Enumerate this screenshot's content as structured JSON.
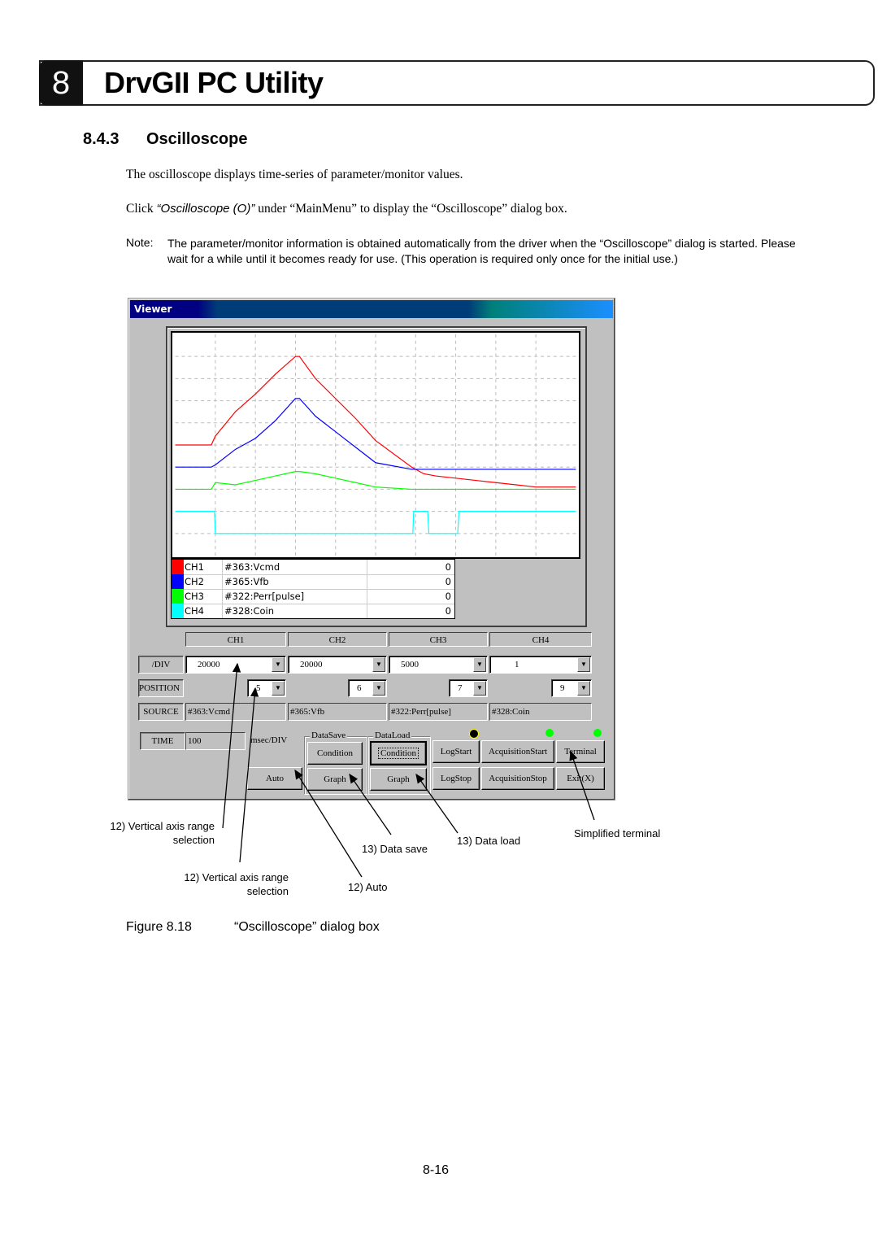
{
  "chapter": {
    "number": "8",
    "title": "DrvGII PC Utility"
  },
  "section": {
    "number": "8.4.3",
    "title": "Oscilloscope"
  },
  "paragraphs": {
    "p1": "The oscilloscope displays time-series of parameter/monitor values.",
    "p2_prefix": "Click ",
    "p2_italic": "“Oscilloscope (O)”",
    "p2_suffix": " under “MainMenu” to display the “Oscilloscope” dialog box."
  },
  "note": {
    "label": "Note:",
    "text": "The parameter/monitor information is obtained automatically from the driver when the “Oscilloscope” dialog is started. Please wait for a while until it becomes ready for use. (This operation is required only once for the initial use.)"
  },
  "window": {
    "title": "Viewer",
    "legend": [
      {
        "channel": "CH1",
        "name": "#363:Vcmd",
        "value": "0",
        "color": "#ff0000"
      },
      {
        "channel": "CH2",
        "name": "#365:Vfb",
        "value": "0",
        "color": "#0000ff"
      },
      {
        "channel": "CH3",
        "name": "#322:Perr[pulse]",
        "value": "0",
        "color": "#00ff00"
      },
      {
        "channel": "CH4",
        "name": "#328:Coin",
        "value": "0",
        "color": "#00ffff"
      }
    ],
    "channel_headers": [
      "CH1",
      "CH2",
      "CH3",
      "CH4"
    ],
    "div_label": "/DIV",
    "div_values": [
      "20000",
      "20000",
      "5000",
      "1"
    ],
    "position_label": "POSITION",
    "position_values": [
      "5",
      "6",
      "7",
      "9"
    ],
    "source_label": "SOURCE",
    "source_values": [
      "#363:Vcmd",
      "#365:Vfb",
      "#322:Perr[pulse]",
      "#328:Coin"
    ],
    "time_label": "TIME",
    "time_value": "100",
    "time_unit": "msec/DIV",
    "datasave_label": "DataSave",
    "dataload_label": "DataLoad",
    "buttons": {
      "save_condition": "Condition",
      "save_graph": "Graph",
      "load_condition": "Condition",
      "load_graph": "Graph",
      "auto": "Auto",
      "log_start": "LogStart",
      "log_stop": "LogStop",
      "acq_start": "AcquisitionStart",
      "acq_stop": "AcquisitionStop",
      "terminal": "Terminal",
      "exit": "Exit(X)"
    },
    "indicators": [
      {
        "name": "log",
        "color": "#000000",
        "border": "#ffff00"
      },
      {
        "name": "acquisition",
        "color": "#00ff00",
        "border": "#00ff00"
      },
      {
        "name": "terminal",
        "color": "#00ff00",
        "border": "#00ff00"
      }
    ]
  },
  "annotations": {
    "vrange1_l1": "12) Vertical axis range",
    "vrange1_l2": "selection",
    "vrange2_l1": "12) Vertical axis range",
    "vrange2_l2": "selection",
    "auto": "12) Auto",
    "data_save": "13) Data save",
    "data_load": "13) Data load",
    "terminal": "Simplified terminal"
  },
  "figure": {
    "number": "Figure 8.18",
    "caption": "“Oscilloscope” dialog box"
  },
  "page_number": "8-16",
  "chart_data": {
    "type": "line",
    "title": "",
    "xlabel": "",
    "ylabel": "",
    "grid": true,
    "x_divisions": 10,
    "y_divisions": 10,
    "x": [
      0,
      0.9,
      1,
      1.5,
      2,
      2.5,
      3,
      3.1,
      3.5,
      4,
      4.5,
      5,
      5.9,
      6.2,
      6.5,
      7,
      7.5,
      8,
      9,
      10
    ],
    "series": [
      {
        "name": "CH1 #363:Vcmd",
        "color": "#ff0000",
        "values": [
          5,
          5,
          5.4,
          6.5,
          7.3,
          8.2,
          9.0,
          9.0,
          8.0,
          7.1,
          6.2,
          5.2,
          4.0,
          3.7,
          3.6,
          3.5,
          3.4,
          3.3,
          3.1,
          3.1
        ]
      },
      {
        "name": "CH2 #365:Vfb",
        "color": "#0000ff",
        "values": [
          4,
          4,
          4.1,
          4.8,
          5.3,
          6.1,
          7.1,
          7.1,
          6.3,
          5.6,
          4.9,
          4.2,
          3.9,
          3.9,
          3.9,
          3.9,
          3.9,
          3.9,
          3.9,
          3.9
        ]
      },
      {
        "name": "CH3 #322:Perr[pulse]",
        "color": "#00ff00",
        "values": [
          3,
          3,
          3.3,
          3.2,
          3.4,
          3.6,
          3.8,
          3.8,
          3.7,
          3.5,
          3.3,
          3.1,
          3.0,
          3.0,
          3.0,
          3.0,
          3.0,
          3.0,
          3.0,
          3.0
        ]
      },
      {
        "name": "CH4 #328:Coin",
        "color": "#00ffff",
        "values": [
          2,
          2,
          1,
          1,
          1,
          1,
          1,
          1,
          1,
          1,
          1,
          1,
          1,
          1,
          1,
          1,
          1,
          1,
          2,
          2
        ]
      }
    ]
  }
}
